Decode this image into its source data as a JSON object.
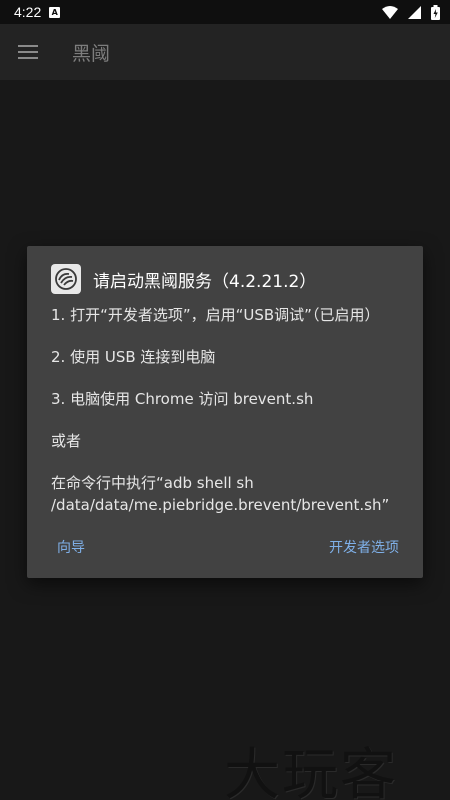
{
  "status_bar": {
    "time": "4:22",
    "notification": "A"
  },
  "app_bar": {
    "title": "黑阈"
  },
  "dialog": {
    "title": "请启动黑阈服务（4.2.21.2）",
    "steps": [
      "1. 打开“开发者选项”，启用“USB调试”（已启用）",
      "2. 使用 USB 连接到电脑",
      "3. 电脑使用 Chrome 访问 brevent.sh"
    ],
    "or_label": "或者",
    "command_text": "在命令行中执行“adb shell sh /data/data/me.piebridge.brevent/brevent.sh”",
    "buttons": {
      "guide": "向导",
      "developer_options": "开发者选项"
    }
  },
  "watermark": "大玩客",
  "colors": {
    "accent": "#7fb0e8",
    "dialog_bg": "#424242",
    "background": "#181818"
  }
}
